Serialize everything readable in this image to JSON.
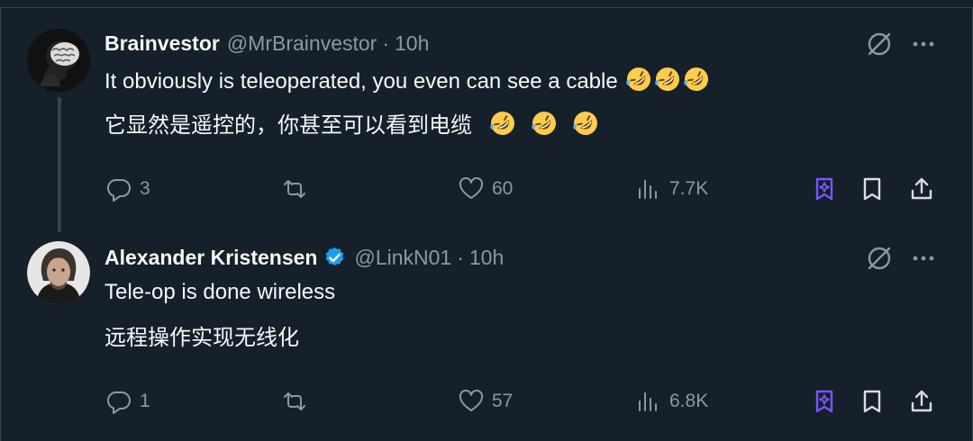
{
  "colors": {
    "background": "#15202b",
    "muted": "#8b98a5",
    "text": "#f7f9f9",
    "verified": "#1d9bf0",
    "accent": "#7856ff"
  },
  "tweets": [
    {
      "name": "Brainvestor",
      "handle": "@MrBrainvestor",
      "separator": "·",
      "time": "10h",
      "verified": false,
      "text_en": "It obviously is teleoperated, you even can see a cable",
      "text_zh": "它显然是遥控的，你甚至可以看到电缆",
      "emoji": "rolling-on-floor-laughing",
      "stats": {
        "replies": "3",
        "reposts": "",
        "likes": "60",
        "views": "7.7K"
      }
    },
    {
      "name": "Alexander Kristensen",
      "handle": "@LinkN01",
      "separator": "·",
      "time": "10h",
      "verified": true,
      "text_en": "Tele-op is done wireless",
      "text_zh": "远程操作实现无线化",
      "stats": {
        "replies": "1",
        "reposts": "",
        "likes": "57",
        "views": "6.8K"
      }
    }
  ]
}
